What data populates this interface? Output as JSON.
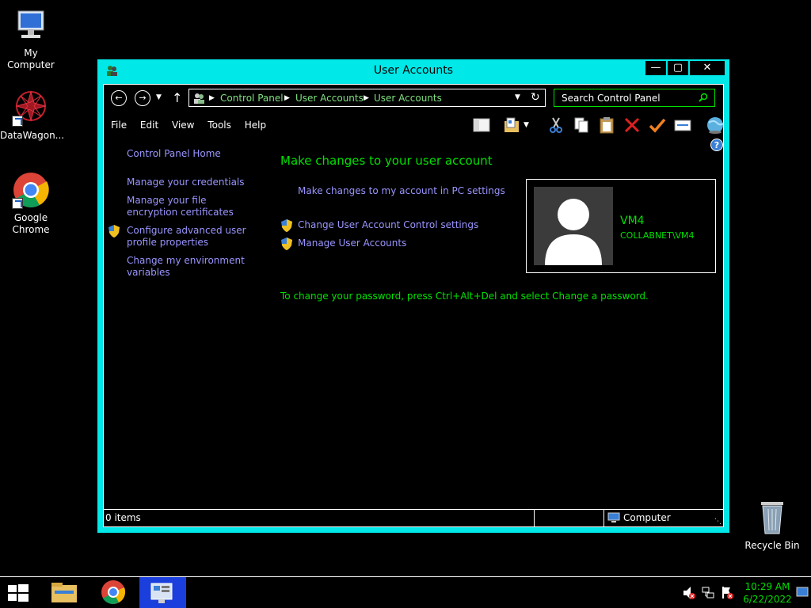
{
  "desktop": {
    "icons": [
      {
        "label": "My Computer"
      },
      {
        "label": "DataWagon..."
      },
      {
        "label": "Google Chrome"
      },
      {
        "label": "Recycle Bin"
      }
    ]
  },
  "window": {
    "title": "User Accounts",
    "buttons": {
      "minimize": "—",
      "maximize": "▢",
      "close": "✕"
    },
    "address": {
      "crumbs": [
        "Control Panel",
        "User Accounts",
        "User Accounts"
      ]
    },
    "search": {
      "placeholder": "Search Control Panel"
    },
    "menu": [
      "File",
      "Edit",
      "View",
      "Tools",
      "Help"
    ],
    "left_pane": {
      "home": "Control Panel Home",
      "links": [
        "Manage your credentials",
        "Manage your file encryption certificates",
        "Configure advanced user profile properties",
        "Change my environment variables"
      ]
    },
    "main": {
      "heading": "Make changes to your user account",
      "pc_settings_link": "Make changes to my account in PC settings",
      "uac_link": "Change User Account Control settings",
      "manage_link": "Manage User Accounts",
      "password_note": "To change your password, press Ctrl+Alt+Del and select Change a password."
    },
    "user": {
      "name": "VM4",
      "domain": "COLLABNET\\VM4"
    },
    "status": {
      "items": "0 items",
      "location": "Computer"
    }
  },
  "taskbar": {
    "time": "10:29 AM",
    "date": "6/22/2022"
  },
  "colors": {
    "window_frame": "#00e8e8",
    "link": "#9a95ff",
    "green_text": "#00e000"
  }
}
